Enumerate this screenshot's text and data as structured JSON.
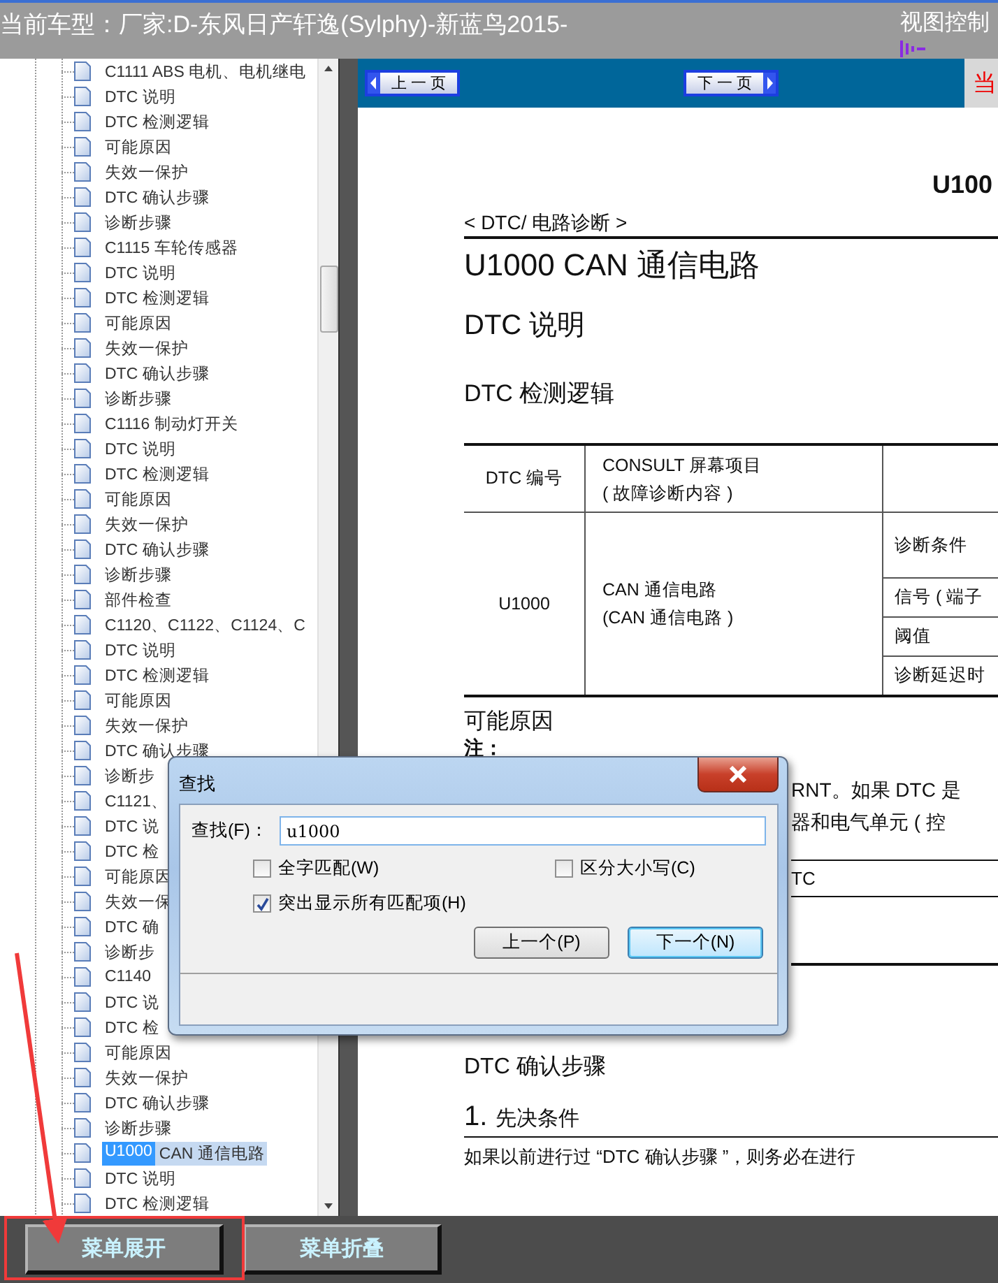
{
  "header": {
    "title": "当前车型：厂家:D-东风日产轩逸(Sylphy)-新蓝鸟2015-",
    "view_control": "视图控制"
  },
  "tree": {
    "items": [
      {
        "label": "C1111 ABS 电机、电机继电",
        "selected": false
      },
      {
        "label": "DTC 说明",
        "selected": false
      },
      {
        "label": "DTC 检测逻辑",
        "selected": false
      },
      {
        "label": "可能原因",
        "selected": false
      },
      {
        "label": "失效一保护",
        "selected": false
      },
      {
        "label": "DTC 确认步骤",
        "selected": false
      },
      {
        "label": "诊断步骤",
        "selected": false
      },
      {
        "label": "C1115 车轮传感器",
        "selected": false
      },
      {
        "label": "DTC 说明",
        "selected": false
      },
      {
        "label": "DTC 检测逻辑",
        "selected": false
      },
      {
        "label": "可能原因",
        "selected": false
      },
      {
        "label": "失效一保护",
        "selected": false
      },
      {
        "label": "DTC 确认步骤",
        "selected": false
      },
      {
        "label": "诊断步骤",
        "selected": false
      },
      {
        "label": "C1116 制动灯开关",
        "selected": false
      },
      {
        "label": "DTC 说明",
        "selected": false
      },
      {
        "label": "DTC 检测逻辑",
        "selected": false
      },
      {
        "label": "可能原因",
        "selected": false
      },
      {
        "label": "失效一保护",
        "selected": false
      },
      {
        "label": "DTC 确认步骤",
        "selected": false
      },
      {
        "label": "诊断步骤",
        "selected": false
      },
      {
        "label": "部件检查",
        "selected": false
      },
      {
        "label": "C1120、C1122、C1124、C",
        "selected": false
      },
      {
        "label": "DTC 说明",
        "selected": false
      },
      {
        "label": "DTC 检测逻辑",
        "selected": false
      },
      {
        "label": "可能原因",
        "selected": false
      },
      {
        "label": "失效一保护",
        "selected": false
      },
      {
        "label": "DTC 确认步骤",
        "selected": false
      },
      {
        "label": "诊断步",
        "selected": false
      },
      {
        "label": "C1121、",
        "selected": false
      },
      {
        "label": "DTC 说",
        "selected": false
      },
      {
        "label": "DTC 检",
        "selected": false
      },
      {
        "label": "可能原因",
        "selected": false
      },
      {
        "label": "失效一保",
        "selected": false
      },
      {
        "label": "DTC 确",
        "selected": false
      },
      {
        "label": "诊断步",
        "selected": false
      },
      {
        "label": "C1140",
        "selected": false
      },
      {
        "label": "DTC 说",
        "selected": false
      },
      {
        "label": "DTC 检",
        "selected": false
      },
      {
        "label": "可能原因",
        "selected": false
      },
      {
        "label": "失效一保护",
        "selected": false
      },
      {
        "label": "DTC 确认步骤",
        "selected": false
      },
      {
        "label": "诊断步骤",
        "selected": false
      },
      {
        "match": "U1000",
        "label": "CAN 通信电路",
        "selected": true
      },
      {
        "label": "DTC 说明",
        "selected": false
      },
      {
        "label": "DTC 检测逻辑",
        "selected": false
      }
    ]
  },
  "toolbar": {
    "buttons": [
      "上 一 页",
      "下 一 页"
    ],
    "page_indicator": "当"
  },
  "document": {
    "corner_heading": "U100",
    "section_tag": "< DTC/ 电路诊断 >",
    "title": "U1000 CAN 通信电路",
    "desc_heading": "DTC 说明",
    "logic_heading": "DTC 检测逻辑",
    "table": {
      "columns": [
        {
          "lines": [
            "DTC 编号"
          ]
        },
        {
          "lines": [
            "CONSULT 屏幕项目",
            "( 故障诊断内容 )"
          ]
        }
      ],
      "rows": [
        {
          "code": "U1000",
          "item_lines": [
            "CAN 通信电路",
            "(CAN 通信电路 )"
          ],
          "conditions": [
            "诊断条件",
            "信号 ( 端子",
            "阈值",
            "诊断延迟时"
          ]
        }
      ]
    },
    "causes_heading": "可能原因",
    "note_label": "注：",
    "note_fragments": [
      "RNT。如果 DTC 是",
      "器和电气单元 ( 控"
    ],
    "fragment_cell": "TC",
    "confirm_heading": "DTC 确认步骤",
    "step_number": "1.",
    "step_title": "先决条件",
    "step_text": "如果以前进行过 “DTC 确认步骤 ”，则务必在进行"
  },
  "dialog": {
    "title": "查找",
    "find_label": "查找(F)：",
    "find_value": "u1000",
    "options": [
      {
        "label": "全字匹配(W)",
        "checked": false
      },
      {
        "label": "区分大小写(C)",
        "checked": false
      },
      {
        "label": "突出显示所有匹配项(H)",
        "checked": true
      }
    ],
    "buttons": [
      {
        "label": "上一个(P)",
        "default": false
      },
      {
        "label": "下一个(N)",
        "default": true
      }
    ]
  },
  "bottom_bar": {
    "buttons": [
      "菜单展开",
      "菜单折叠"
    ]
  }
}
